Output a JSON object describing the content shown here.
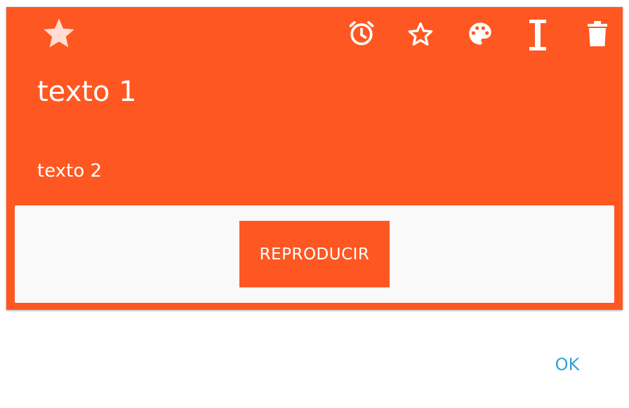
{
  "card": {
    "title": "texto 1",
    "subtitle": "texto 2",
    "background_color": "#ff5722",
    "icons": {
      "favorite": "star-filled-icon",
      "alarm": "alarm-icon",
      "star": "star-outline-icon",
      "palette": "palette-icon",
      "text": "text-cursor-icon",
      "delete": "trash-icon"
    }
  },
  "panel": {
    "play_label": "REPRODUCIR"
  },
  "dialog": {
    "ok_label": "OK",
    "accent_color": "#33a2d8"
  }
}
